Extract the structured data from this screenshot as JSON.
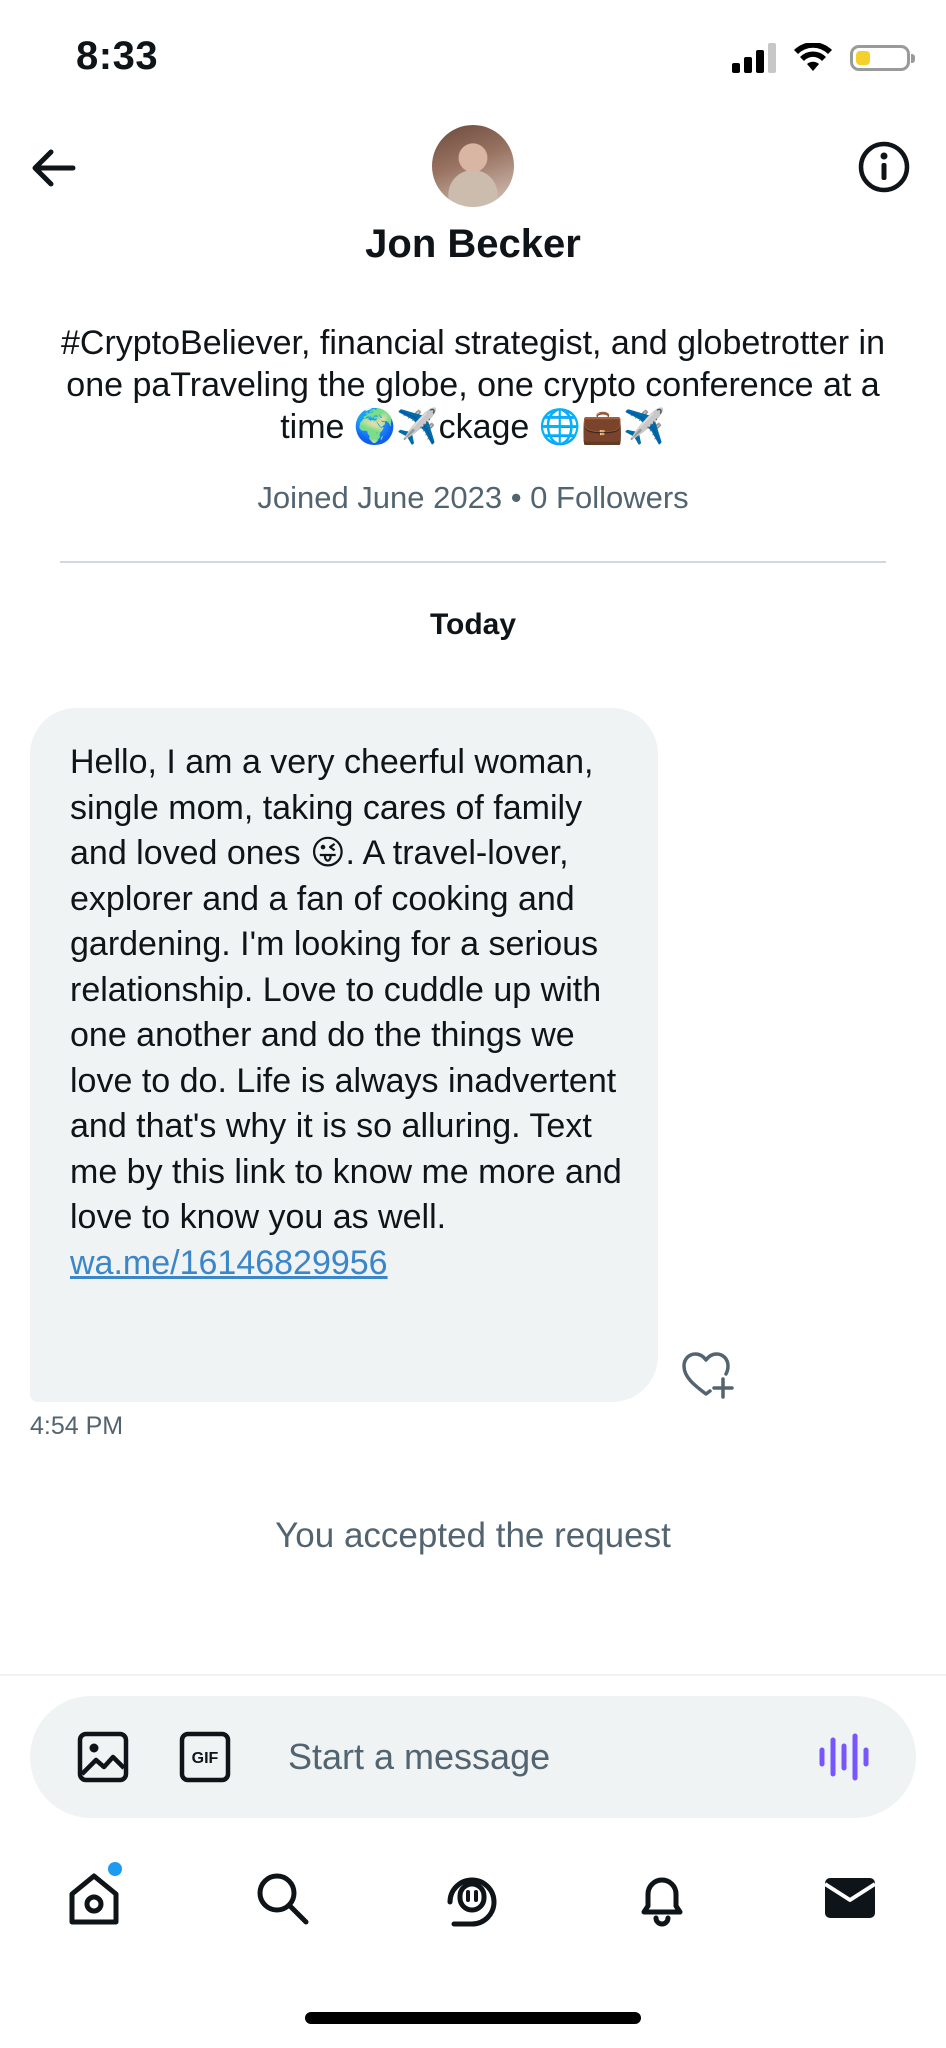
{
  "status_bar": {
    "time": "8:33",
    "icons": [
      "cellular-signal-icon",
      "wifi-icon",
      "battery-icon"
    ],
    "battery_level": 0.3
  },
  "header": {
    "back_icon": "arrow-left-icon",
    "info_icon": "info-icon",
    "display_name": "Jon Becker",
    "bio": "#CryptoBeliever, financial strategist, and globetrotter in one paTraveling the globe, one crypto conference at a time 🌍✈️ckage 🌐💼✈️",
    "joined": "Joined June 2023 • 0 Followers"
  },
  "conversation": {
    "day_label": "Today",
    "message": {
      "text": "Hello, I am a very cheerful woman, single mom, taking cares of family and loved ones 😜. A travel-lover, explorer and a fan of cooking and gardening. I'm looking for a serious relationship. Love to cuddle up with one another and do the things we love to do. Life is always inadvertent and that's why it is so alluring. Text me by this link to know me more and love to know you as well.",
      "link": "wa.me/16146829956",
      "time": "4:54 PM",
      "reaction_icon": "heart-plus-icon"
    },
    "accepted_note": "You accepted the request"
  },
  "composer": {
    "placeholder": "Start a message",
    "gif_label": "GIF",
    "icons": [
      "image-icon",
      "gif-icon",
      "voice-icon"
    ],
    "accent_color": "#7856ff"
  },
  "tab_bar": {
    "tabs": [
      "home-icon",
      "search-icon",
      "spaces-icon",
      "notifications-icon",
      "messages-icon"
    ],
    "active": "messages",
    "badge_color": "#1d9bf0"
  },
  "colors": {
    "text_primary": "#0f1419",
    "text_secondary": "#536471",
    "bubble_bg": "#eff3f4",
    "link": "#3a86c8"
  }
}
